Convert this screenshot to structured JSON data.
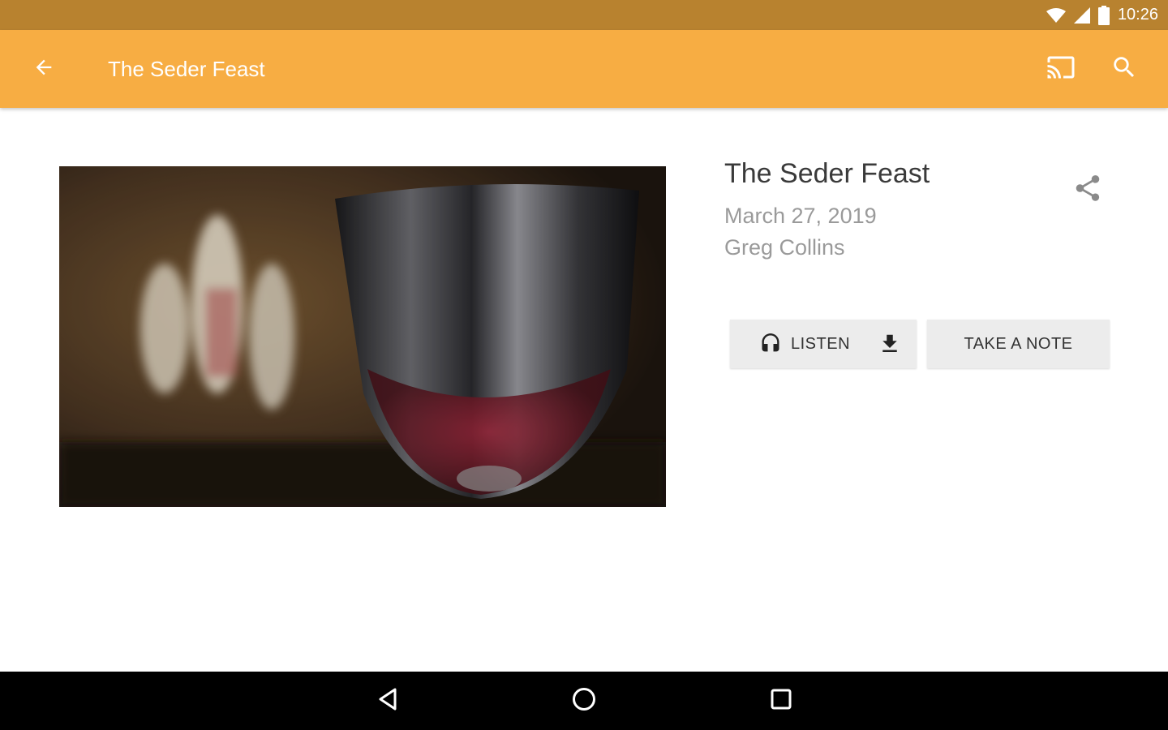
{
  "status_bar": {
    "time": "10:26",
    "icons": [
      "wifi-icon",
      "signal-icon",
      "battery-icon"
    ]
  },
  "app_bar": {
    "title": "The Seder Feast",
    "icons": [
      "back-arrow-icon",
      "cast-icon",
      "search-icon"
    ]
  },
  "sermon": {
    "title": "The Seder Feast",
    "date": "March 27, 2019",
    "speaker": "Greg Collins",
    "artwork": "chalice-photo"
  },
  "actions": {
    "listen_label": "LISTEN",
    "take_note_label": "TAKE A NOTE",
    "icons": [
      "share-icon",
      "headphones-icon",
      "download-icon"
    ]
  },
  "nav_bar": {
    "icons": [
      "back-triangle-icon",
      "home-circle-icon",
      "recents-square-icon"
    ]
  },
  "colors": {
    "status_bar": "#b8822f",
    "app_bar": "#f7ad43",
    "button_bg": "#ececec",
    "nav_bar": "#000000"
  }
}
